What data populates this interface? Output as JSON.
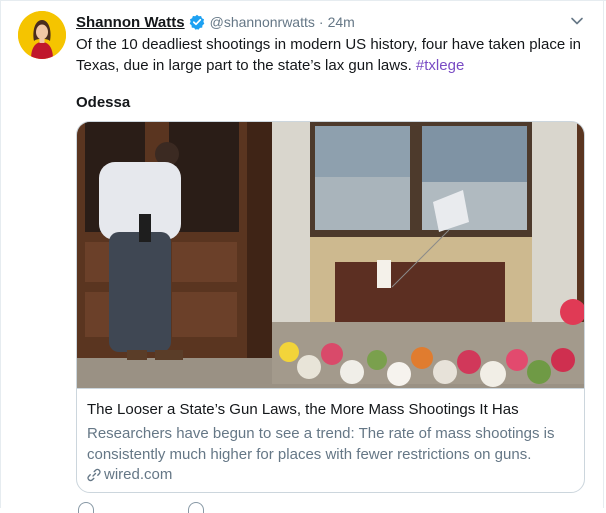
{
  "tweet": {
    "author_name": "Shannon Watts",
    "handle": "@shannonrwatts",
    "separator": "·",
    "time": "24m",
    "text_main": "Of the 10 deadliest shootings in modern US history, four have taken place in Texas, due in large part to the state’s lax gun laws.",
    "hashtag": "#txlege",
    "subheading": "Odessa"
  },
  "card": {
    "title": "The Looser a State’s Gun Laws, the More Mass Shootings It Has",
    "description": "Researchers have begun to see a trend: The rate of mass shootings is consistently much higher for places with fewer restrictions on guns.",
    "domain": "wired.com"
  },
  "icons": {
    "verified": "verified-badge-icon",
    "caret": "chevron-down-icon",
    "link": "link-icon"
  },
  "colors": {
    "verified_blue": "#1da1f2",
    "hashtag_purple": "#794bc4",
    "secondary_text": "#657786",
    "avatar_yellow": "#f5c400"
  }
}
